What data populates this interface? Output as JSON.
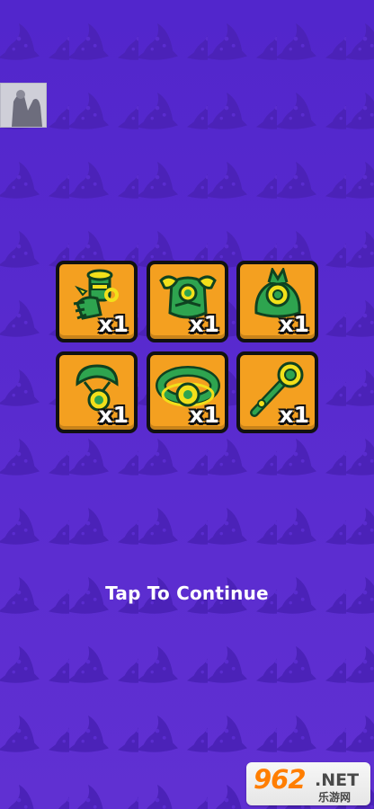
{
  "background": {
    "color": "#5b2bd0",
    "pattern_icon": "wizard-hat-icon"
  },
  "rewards": [
    {
      "name": "gauntlet-icon",
      "quantity": "x1"
    },
    {
      "name": "chest-armor-icon",
      "quantity": "x1"
    },
    {
      "name": "helmet-icon",
      "quantity": "x1"
    },
    {
      "name": "amulet-icon",
      "quantity": "x1"
    },
    {
      "name": "belt-icon",
      "quantity": "x1"
    },
    {
      "name": "staff-icon",
      "quantity": "x1"
    }
  ],
  "prompt": "Tap To Continue",
  "watermark": {
    "logo": "962",
    "domain": ".NET",
    "sub": "乐游网"
  },
  "colors": {
    "card_fill": "#f4a020",
    "item_green": "#2ea44f",
    "item_yellow": "#f2e01a"
  }
}
